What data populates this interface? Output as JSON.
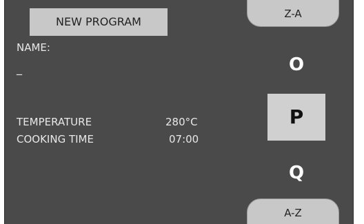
{
  "buttons": {
    "new_program": "NEW PROGRAM",
    "sort_desc": "Z-A",
    "sort_asc": "A-Z"
  },
  "form": {
    "name_label": "NAME:",
    "name_value": "_",
    "temperature_label": "TEMPERATURE",
    "temperature_value": "280°C",
    "cooking_time_label": "COOKING TIME",
    "cooking_time_value": "07:00"
  },
  "letter_picker": {
    "prev": "O",
    "selected": "P",
    "next": "Q"
  }
}
